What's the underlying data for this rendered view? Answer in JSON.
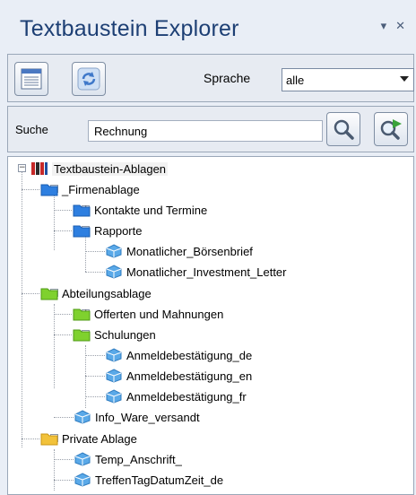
{
  "panel": {
    "title": "Textbaustein Explorer",
    "pin_icon": "▾",
    "close_icon": "✕"
  },
  "toolbar": {
    "language_label": "Sprache",
    "language_value": "alle"
  },
  "search": {
    "label": "Suche",
    "value": "Rechnung"
  },
  "tree": {
    "root": "Textbaustein-Ablagen",
    "firmenablage": "_Firmenablage",
    "kontakte": "Kontakte und Termine",
    "rapporte": "Rapporte",
    "boersenbrief": "Monatlicher_Börsenbrief",
    "investment": "Monatlicher_Investment_Letter",
    "abteilungsablage": "Abteilungsablage",
    "offerten": "Offerten und Mahnungen",
    "schulungen": "Schulungen",
    "anm_de": "Anmeldebestätigung_de",
    "anm_en": "Anmeldebestätigung_en",
    "anm_fr": "Anmeldebestätigung_fr",
    "info_ware": "Info_Ware_versandt",
    "private": "Private Ablage",
    "temp": "Temp_Anschrift_",
    "treffen": "TreffenTagDatumZeit_de"
  },
  "colors": {
    "title": "#1d3f74",
    "folder_blue": "#2e7fe0",
    "folder_green": "#7fd12e",
    "folder_yellow": "#f2c23a",
    "cube": "#5aa9e8"
  }
}
